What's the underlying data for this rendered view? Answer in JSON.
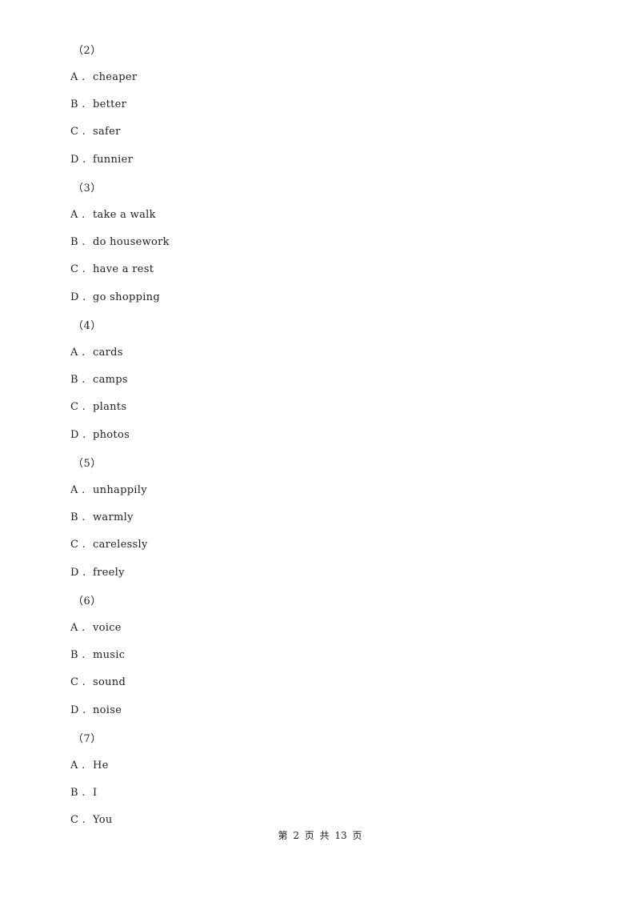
{
  "questions": [
    {
      "number": "（2）",
      "options": [
        {
          "letter": "A .",
          "text": "cheaper"
        },
        {
          "letter": "B .",
          "text": "better"
        },
        {
          "letter": "C .",
          "text": "safer"
        },
        {
          "letter": "D .",
          "text": "funnier"
        }
      ]
    },
    {
      "number": "（3）",
      "options": [
        {
          "letter": "A .",
          "text": "take a walk"
        },
        {
          "letter": "B .",
          "text": "do housework"
        },
        {
          "letter": "C .",
          "text": "have a rest"
        },
        {
          "letter": "D .",
          "text": "go shopping"
        }
      ]
    },
    {
      "number": "（4）",
      "options": [
        {
          "letter": "A .",
          "text": "cards"
        },
        {
          "letter": "B .",
          "text": "camps"
        },
        {
          "letter": "C .",
          "text": "plants"
        },
        {
          "letter": "D .",
          "text": "photos"
        }
      ]
    },
    {
      "number": "（5）",
      "options": [
        {
          "letter": "A .",
          "text": "unhappily"
        },
        {
          "letter": "B .",
          "text": "warmly"
        },
        {
          "letter": "C .",
          "text": "carelessly"
        },
        {
          "letter": "D .",
          "text": "freely"
        }
      ]
    },
    {
      "number": "（6）",
      "options": [
        {
          "letter": "A .",
          "text": "voice"
        },
        {
          "letter": "B .",
          "text": "music"
        },
        {
          "letter": "C .",
          "text": "sound"
        },
        {
          "letter": "D .",
          "text": "noise"
        }
      ]
    },
    {
      "number": "（7）",
      "options": [
        {
          "letter": "A .",
          "text": "He"
        },
        {
          "letter": "B .",
          "text": "I"
        },
        {
          "letter": "C .",
          "text": "You"
        }
      ]
    }
  ],
  "footer": {
    "text": "第 2 页 共 13 页"
  }
}
